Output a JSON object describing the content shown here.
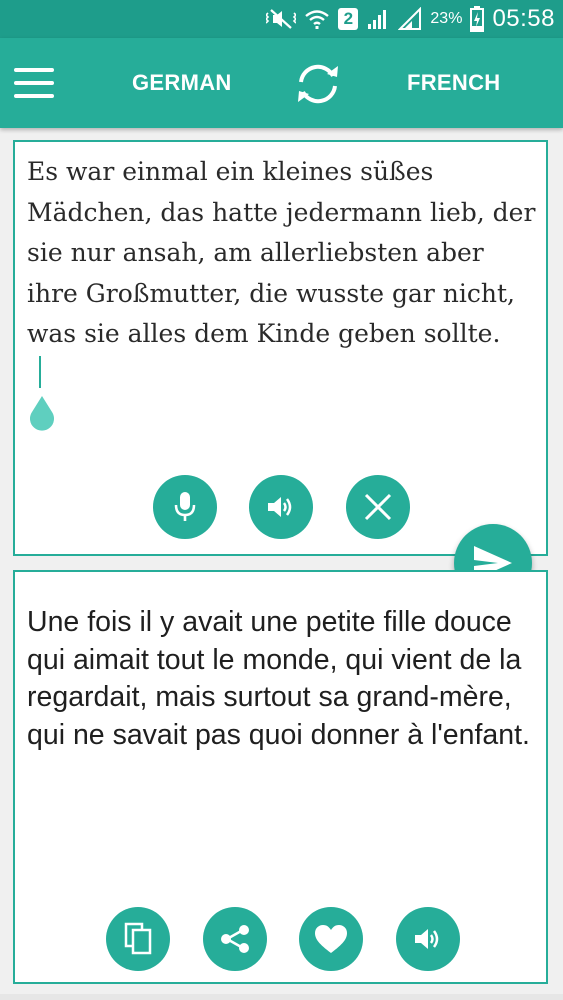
{
  "status_bar": {
    "sim_slot": "2",
    "battery": "23%",
    "time": "05:58",
    "icons": [
      "mute-vibrate-icon",
      "wifi-icon",
      "sim-2-badge",
      "signal-icon",
      "signal-icon",
      "battery-charging-icon"
    ]
  },
  "app_bar": {
    "source_language": "GERMAN",
    "target_language": "FRENCH",
    "icons": [
      "menu-icon",
      "swap-languages-icon"
    ]
  },
  "source_panel": {
    "text": "Es war einmal ein kleines süßes Mädchen, das hatte jedermann lieb, der sie nur ansah, am allerliebsten aber ihre Großmutter, die wusste gar nicht, was sie alles dem Kinde geben sollte.",
    "buttons": [
      "microphone-icon",
      "speaker-icon",
      "clear-icon"
    ]
  },
  "send_button": {
    "icon": "send-icon"
  },
  "result_panel": {
    "text": "Une fois il y avait une petite fille douce qui aimait tout le monde, qui vient de la regardait, mais surtout sa grand-mère, qui ne savait pas quoi donner à l'enfant.",
    "buttons": [
      "copy-icon",
      "share-icon",
      "favorite-icon",
      "speaker-icon"
    ]
  },
  "colors": {
    "status_bar": "#1e9d8b",
    "app_bar": "#26ad99",
    "accent": "#26ad99",
    "background": "#f0f0f0",
    "panel_background": "#ffffff"
  }
}
